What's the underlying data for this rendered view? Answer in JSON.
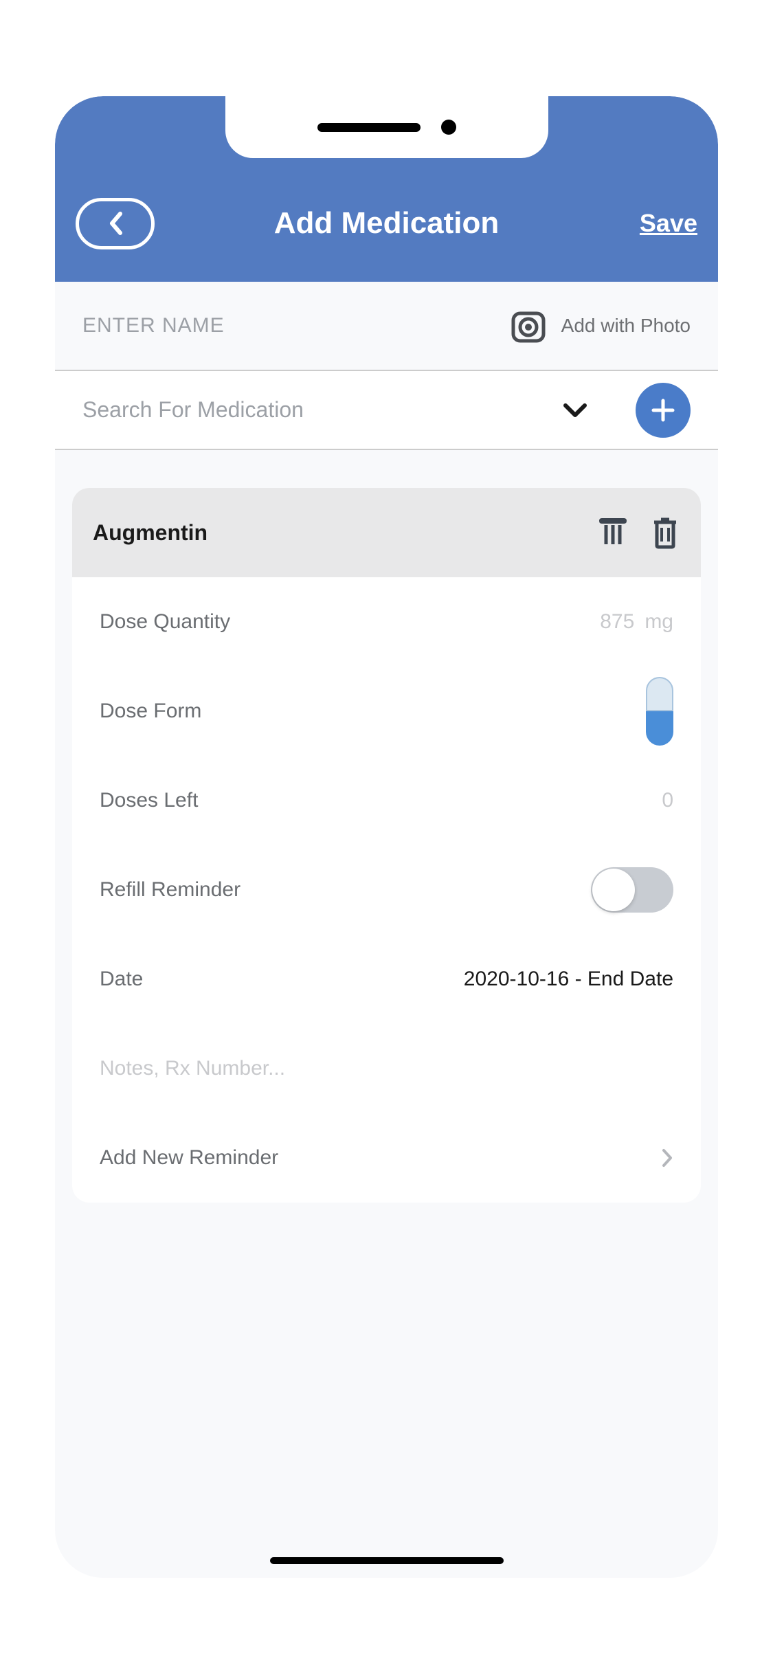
{
  "header": {
    "title": "Add Medication",
    "save_label": "Save"
  },
  "name_section": {
    "placeholder": "ENTER NAME",
    "photo_label": "Add with Photo"
  },
  "search": {
    "placeholder": "Search For Medication"
  },
  "medication": {
    "name": "Augmentin",
    "dose_quantity_label": "Dose Quantity",
    "dose_value": "875",
    "dose_unit": "mg",
    "dose_form_label": "Dose Form",
    "doses_left_label": "Doses Left",
    "doses_left_value": "0",
    "refill_label": "Refill Reminder",
    "date_label": "Date",
    "date_value": "2020-10-16 - End Date",
    "notes_placeholder": "Notes, Rx Number...",
    "add_reminder_label": "Add New Reminder"
  }
}
